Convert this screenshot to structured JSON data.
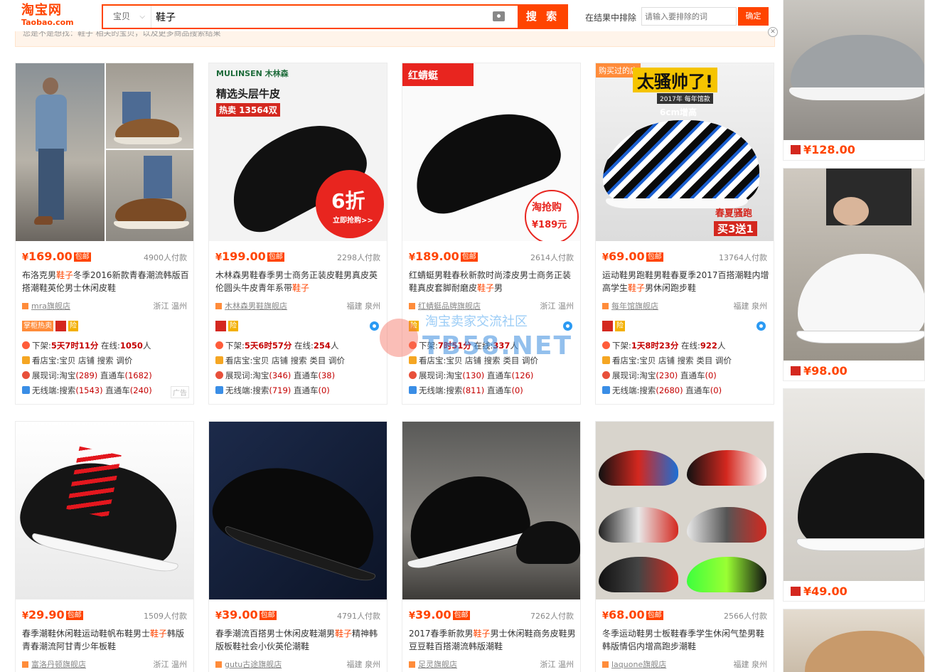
{
  "header": {
    "logo_cn": "淘宝网",
    "logo_en": "Taobao.com",
    "search_type": "宝贝",
    "search_query": "鞋子",
    "search_button": "搜 索",
    "exclude_label": "在结果中排除",
    "exclude_placeholder": "请输入要排除的词",
    "exclude_button": "确定"
  },
  "notice": "您是不是想找：鞋子 相关的宝贝，以及更多商品搜索结果",
  "colors": {
    "accent": "#ff4400",
    "price": "#ff4400",
    "highlight": "#ff4400",
    "text": "#3c3c3c"
  },
  "products": [
    {
      "price": "169.00",
      "baoyou": "包邮",
      "deal": "4900人付款",
      "title_a": "布洛克男",
      "title_hl": "鞋子",
      "title_b": "冬季2016新款青春潮流韩版百搭潮鞋英伦男士休闲皮鞋",
      "shop": "mra旗舰店",
      "location": "浙江 温州",
      "badges": [
        "掌柜热卖",
        "",
        "险"
      ],
      "pic_tag": "",
      "shelf_label": "下架:",
      "shelf": "5天7时11分",
      "online_label": " 在线:",
      "online": "1050",
      "online_unit": "人",
      "store_line": "看店宝:宝贝 店铺 搜索 调价",
      "show_label": "展现词:淘宝",
      "show_tb": "(289)",
      "show_ztc_label": " 直通车",
      "show_ztc": "(1682)",
      "mobile_label": "无线端:搜索",
      "mobile_s": "(1543)",
      "mobile_ztc_label": " 直通车",
      "mobile_ztc": "(240)",
      "ad": "广告"
    },
    {
      "price": "199.00",
      "baoyou": "包邮",
      "deal": "2298人付款",
      "title_a": "木林森男鞋春季男士商务正装皮鞋男真皮英伦圆头牛皮青年系带",
      "title_hl": "鞋子",
      "title_b": "",
      "shop": "木林森男鞋旗舰店",
      "location": "福建 泉州",
      "badges": [
        "",
        "险"
      ],
      "pic_tag": "MULINSEN 木林森",
      "pic_title": "精选头层牛皮",
      "pic_sale": "热卖 13564双",
      "pic_discount": "6折",
      "pic_discount_sub": "立即抢购>>",
      "shelf_label": "下架:",
      "shelf": "5天6时57分",
      "online_label": " 在线:",
      "online": "254",
      "online_unit": "人",
      "store_line": "看店宝:宝贝 店铺 搜索 类目 调价",
      "show_label": "展现词:淘宝",
      "show_tb": "(346)",
      "show_ztc_label": " 直通车",
      "show_ztc": "(38)",
      "mobile_label": "无线端:搜索",
      "mobile_s": "(719)",
      "mobile_ztc_label": " 直通车",
      "mobile_ztc": "(0)",
      "ad": ""
    },
    {
      "price": "189.00",
      "baoyou": "包邮",
      "deal": "2614人付款",
      "title_a": "红蜻蜓男鞋春秋新款时尚漆皮男士商务正装鞋真皮套脚耐磨皮",
      "title_hl": "鞋子",
      "title_b": "男",
      "shop": "红蜻蜓品牌旗舰店",
      "location": "浙江 温州",
      "badges": [
        "险"
      ],
      "pic_tag": "红蜻蜓",
      "pic_sale": "淘抢购",
      "pic_price": "¥189元",
      "shelf_label": "下架:",
      "shelf": "7时51分",
      "online_label": " 在线:",
      "online": "337",
      "online_unit": "人",
      "store_line": "看店宝:宝贝 店铺 搜索 类目 调价",
      "show_label": "展现词:淘宝",
      "show_tb": "(130)",
      "show_ztc_label": " 直通车",
      "show_ztc": "(126)",
      "mobile_label": "无线端:搜索",
      "mobile_s": "(811)",
      "mobile_ztc_label": " 直通车",
      "mobile_ztc": "(0)",
      "ad": ""
    },
    {
      "price": "69.00",
      "baoyou": "包邮",
      "deal": "13764人付款",
      "title_a": "运动鞋男跑鞋男鞋春夏季2017百搭潮鞋内增高学生",
      "title_hl": "鞋子",
      "title_b": "男休闲跑步鞋",
      "shop": "每年馆旗舰店",
      "location": "福建 泉州",
      "badges": [
        "",
        "险"
      ],
      "pic_tag": "购买过的店",
      "pic_title": "太骚帅了!",
      "pic_sub": "2017年 每年馆款",
      "pic_height": "6cm增高",
      "pic_promo": "春夏骚跑",
      "pic_promo2": "买3送1",
      "shelf_label": "下架:",
      "shelf": "1天8时23分",
      "online_label": " 在线:",
      "online": "922",
      "online_unit": "人",
      "store_line": "看店宝:宝贝 店铺 搜索 类目 调价",
      "show_label": "展现词:淘宝",
      "show_tb": "(230)",
      "show_ztc_label": " 直通车",
      "show_ztc": "(0)",
      "mobile_label": "无线端:搜索",
      "mobile_s": "(2680)",
      "mobile_ztc_label": " 直通车",
      "mobile_ztc": "(0)",
      "ad": ""
    },
    {
      "price": "29.90",
      "baoyou": "包邮",
      "deal": "1509人付款",
      "title_a": "春季潮鞋休闲鞋运动鞋帆布鞋男士",
      "title_hl": "鞋子",
      "title_b": "韩版青春潮流阿甘青少年板鞋",
      "shop": "富洛丹顿旗舰店",
      "location": "浙江 温州"
    },
    {
      "price": "39.00",
      "baoyou": "包邮",
      "deal": "4791人付款",
      "title_a": "春季潮流百搭男士休闲皮鞋潮男",
      "title_hl": "鞋子",
      "title_b": "精神韩版板鞋社会小伙英伦潮鞋",
      "shop": "gutu古途旗舰店",
      "location": "福建 泉州"
    },
    {
      "price": "39.00",
      "baoyou": "包邮",
      "deal": "7262人付款",
      "title_a": "2017春季新款男",
      "title_hl": "鞋子",
      "title_b": "男士休闲鞋商务皮鞋男豆豆鞋百搭潮流韩版潮鞋",
      "shop": "足灵旗舰店",
      "location": "浙江 温州"
    },
    {
      "price": "68.00",
      "baoyou": "包邮",
      "deal": "2566人付款",
      "title_a": "冬季运动鞋男士板鞋春季学生休闲气垫男鞋韩版情侣内增高跑步潮鞋",
      "title_hl": "",
      "title_b": "",
      "shop": "laquone旗舰店",
      "location": "福建 泉州"
    }
  ],
  "right_column": [
    {
      "price": "¥128.00"
    },
    {
      "price": "¥98.00"
    },
    {
      "price": "¥49.00"
    }
  ],
  "watermark": {
    "line1": "淘宝卖家交流社区",
    "line2": "TB58.NET"
  }
}
